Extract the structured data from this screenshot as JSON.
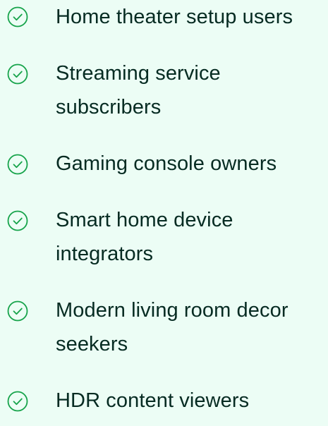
{
  "audience_list": {
    "icon": "check-circle-icon",
    "icon_color": "#16a34a",
    "text_color": "#062b22",
    "background_color": "#ecfdf5",
    "items": [
      {
        "label": "Home theater setup users"
      },
      {
        "label": "Streaming service subscribers"
      },
      {
        "label": "Gaming console owners"
      },
      {
        "label": "Smart home device integrators"
      },
      {
        "label": "Modern living room decor seekers"
      },
      {
        "label": "HDR content viewers"
      }
    ]
  }
}
